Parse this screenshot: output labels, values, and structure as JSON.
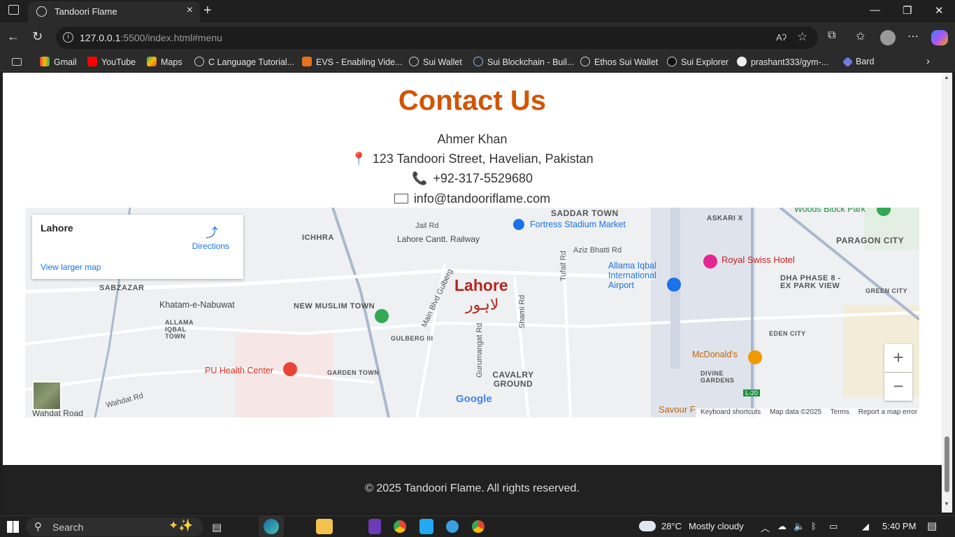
{
  "browser": {
    "tab_title": "Tandoori Flame",
    "url_host": "127.0.0.1",
    "url_rest": ":5500/index.html#menu",
    "read_aloud": "Aʔ",
    "bookmarks": [
      "Gmail",
      "YouTube",
      "Maps",
      "C Language Tutorial...",
      "EVS - Enabling Vide...",
      "Sui Wallet",
      "Sui Blockchain - Buil...",
      "Ethos Sui Wallet",
      "Sui Explorer",
      "prashant333/gym-...",
      "Bard"
    ]
  },
  "page": {
    "heading": "Contact Us",
    "name": "Ahmer Khan",
    "address": "123 Tandoori Street, Havelian, Pakistan",
    "phone": "+92-317-5529680",
    "email": "info@tandooriflame.com",
    "footer": "© 2025 Tandoori Flame. All rights reserved."
  },
  "map": {
    "card_place": "Lahore",
    "card_directions": "Directions",
    "card_larger": "View larger map",
    "city_label": "Lahore",
    "city_label_urdu": "لاہور",
    "labels": [
      "SADDAR TOWN",
      "ASKARI X",
      "PARAGON CITY",
      "Woods Block Park",
      "Fortress Stadium Market",
      "Lahore Cantt. Railway",
      "Jail Rd",
      "ICHHRA",
      "Aziz Bhatti Rd",
      "Tufail Rd",
      "Allama Iqbal International Airport",
      "Royal Swiss Hotel",
      "DHA PHASE 8 - EX PARK VIEW",
      "GREEN CITY",
      "SABZAZAR",
      "Khatam-e-Nabuwat",
      "ALLAMA IQBAL TOWN",
      "NEW MUSLIM TOWN",
      "Main Blvd Gulberg",
      "Shami Rd",
      "GULBERG III",
      "EDEN CITY",
      "McDonald's",
      "DIVINE GARDENS",
      "PU Health Center",
      "GARDEN TOWN",
      "Gurumangat Rd",
      "CAVALRY GROUND",
      "Wahdat Rd",
      "Wahdat Road",
      "Savour F",
      "L-20"
    ],
    "attribution": [
      "Keyboard shortcuts",
      "Map data ©2025",
      "Terms",
      "Report a map error"
    ],
    "google": "Google",
    "zoom_in": "+",
    "zoom_out": "−"
  },
  "taskbar": {
    "search": "Search",
    "temperature": "28°C",
    "weather": "Mostly cloudy",
    "time": "5:40 PM"
  }
}
